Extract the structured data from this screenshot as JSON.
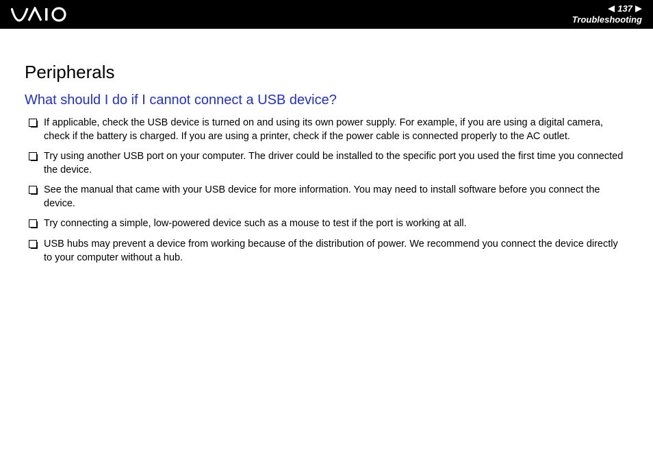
{
  "header": {
    "page_number": "137",
    "section": "Troubleshooting"
  },
  "content": {
    "title": "Peripherals",
    "question": "What should I do if I cannot connect a USB device?",
    "items": [
      "If applicable, check the USB device is turned on and using its own power supply. For example, if you are using a digital camera, check if the battery is charged. If you are using a printer, check if the power cable is connected properly to the AC outlet.",
      "Try using another USB port on your computer. The driver could be installed to the specific port you used the first time you connected the device.",
      "See the manual that came with your USB device for more information. You may need to install software before you connect the device.",
      "Try connecting a simple, low-powered device such as a mouse to test if the port is working at all.",
      "USB hubs may prevent a device from working because of the distribution of power. We recommend you connect the device directly to your computer without a hub."
    ]
  }
}
